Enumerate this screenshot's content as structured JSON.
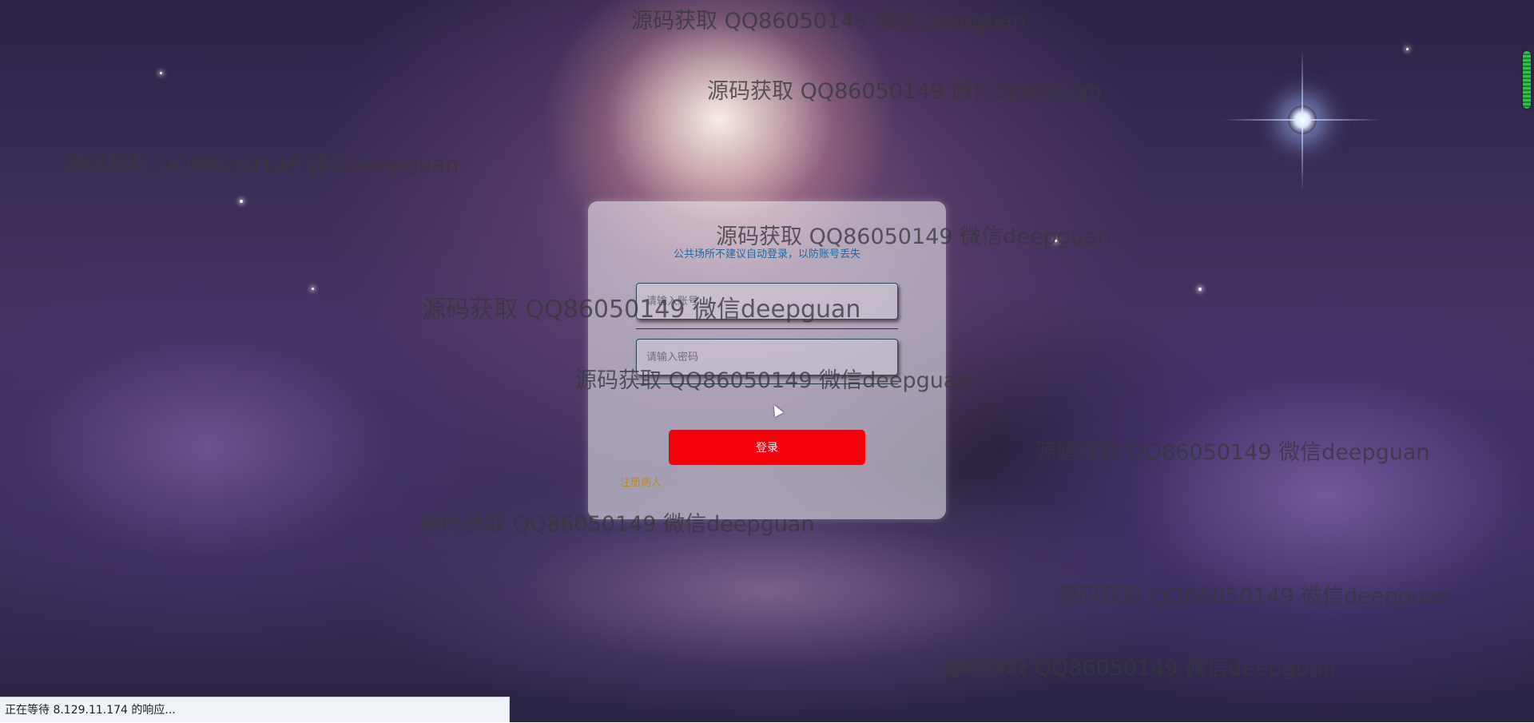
{
  "login": {
    "notice": "公共场所不建议自动登录，以防账号丢失",
    "username_placeholder": "请输入账号",
    "password_placeholder": "请输入密码",
    "login_button": "登录",
    "register_link": "注册病人"
  },
  "watermark": {
    "text": "源码获取 QQ86050149 微信deepguan"
  },
  "status_bar": {
    "text": "正在等待 8.129.11.174 的响应..."
  },
  "colors": {
    "login_button": "#f5000a",
    "notice_text": "#1d6aa3",
    "register_link": "#b58a2a"
  }
}
